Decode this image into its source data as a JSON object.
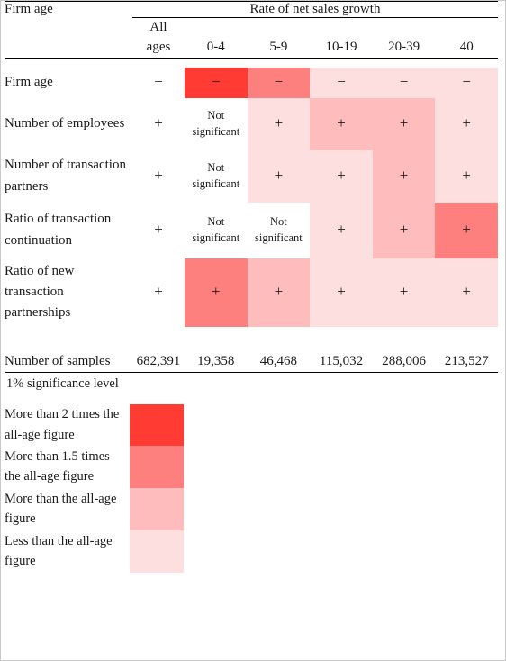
{
  "table": {
    "corner_label": "Firm age",
    "group_header": "Rate of net sales growth",
    "columns": [
      {
        "key": "all",
        "label_line1": "All",
        "label_line2": "ages"
      },
      {
        "key": "0-4",
        "label_line1": "",
        "label_line2": "0-4"
      },
      {
        "key": "5-9",
        "label_line1": "",
        "label_line2": "5-9"
      },
      {
        "key": "10-19",
        "label_line1": "",
        "label_line2": "10-19"
      },
      {
        "key": "20-39",
        "label_line1": "",
        "label_line2": "20-39"
      },
      {
        "key": "40",
        "label_line1": "",
        "label_line2": "40"
      }
    ],
    "rows": [
      {
        "label_lines": [
          "Firm age"
        ],
        "all": "−",
        "cells": [
          {
            "text": "−",
            "level": 1
          },
          {
            "text": "−",
            "level": 2
          },
          {
            "text": "−",
            "level": 4
          },
          {
            "text": "−",
            "level": 4
          },
          {
            "text": "−",
            "level": 4
          }
        ]
      },
      {
        "label_lines": [
          "Number of employees"
        ],
        "all": "+",
        "cells": [
          {
            "text": "Not significant",
            "level": 0
          },
          {
            "text": "+",
            "level": 4
          },
          {
            "text": "+",
            "level": 3
          },
          {
            "text": "+",
            "level": 3
          },
          {
            "text": "+",
            "level": 4
          }
        ]
      },
      {
        "label_lines": [
          "Number of transaction",
          "partners"
        ],
        "all": "+",
        "cells": [
          {
            "text": "Not significant",
            "level": 0
          },
          {
            "text": "+",
            "level": 4
          },
          {
            "text": "+",
            "level": 4
          },
          {
            "text": "+",
            "level": 3
          },
          {
            "text": "+",
            "level": 4
          }
        ]
      },
      {
        "label_lines": [
          "Ratio of transaction",
          "continuation"
        ],
        "all": "+",
        "cells": [
          {
            "text": "Not significant",
            "level": 0
          },
          {
            "text": "Not significant",
            "level": 0
          },
          {
            "text": "+",
            "level": 4
          },
          {
            "text": "+",
            "level": 3
          },
          {
            "text": "+",
            "level": 2
          }
        ]
      },
      {
        "label_lines": [
          "Ratio of new",
          "transaction",
          "partnerships"
        ],
        "all": "+",
        "cells": [
          {
            "text": "+",
            "level": 2
          },
          {
            "text": "+",
            "level": 3
          },
          {
            "text": "+",
            "level": 4
          },
          {
            "text": "+",
            "level": 4
          },
          {
            "text": "+",
            "level": 4
          }
        ]
      }
    ],
    "samples": {
      "label": "Number of samples",
      "values": [
        "682,391",
        "19,358",
        "46,468",
        "115,032",
        "288,006",
        "213,527"
      ]
    },
    "footnote": "1% significance level"
  },
  "legend": {
    "items": [
      {
        "text": "More than 2 times the all-age figure",
        "level": 1
      },
      {
        "text": "More than 1.5 times the all-age figure",
        "level": 2
      },
      {
        "text": "More than the all-age figure",
        "level": 3
      },
      {
        "text": "Less than the all-age figure",
        "level": 4
      }
    ]
  },
  "colors": {
    "level0": "#ffffff",
    "level1": "#ff3b33",
    "level2": "#fd807f",
    "level3": "#ffbcbd",
    "level4": "#fedfe0",
    "rule": "#000000",
    "text": "#1a1a1a"
  }
}
